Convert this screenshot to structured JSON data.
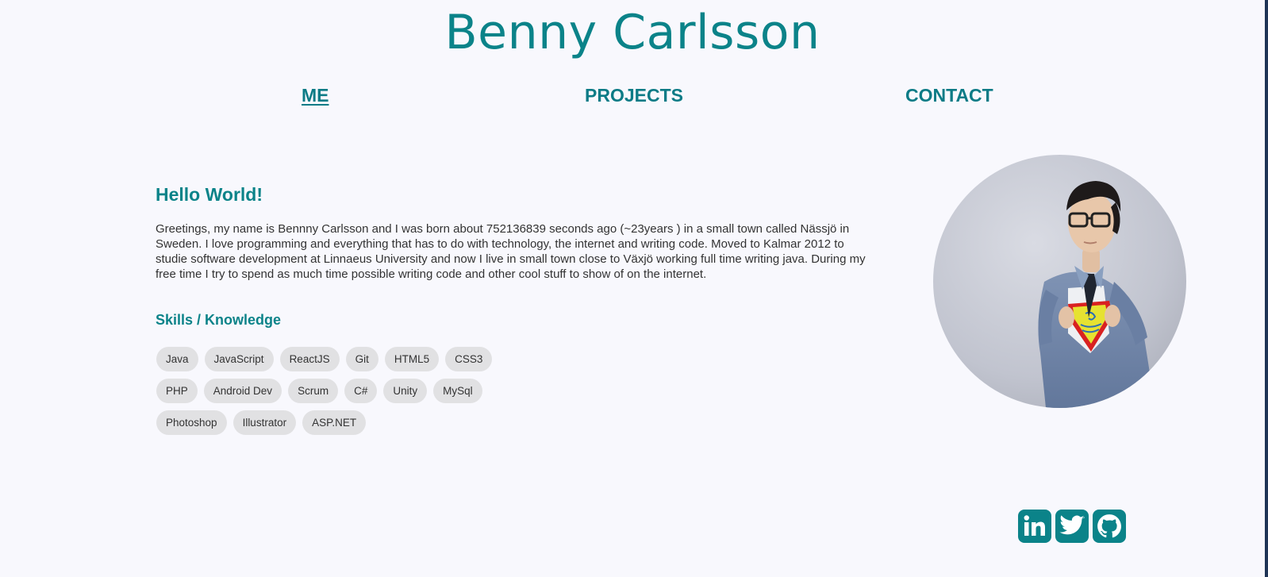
{
  "header": {
    "title": "Benny Carlsson"
  },
  "nav": {
    "items": [
      {
        "label": "ME"
      },
      {
        "label": "PROJECTS"
      },
      {
        "label": "CONTACT"
      }
    ],
    "active": "ME"
  },
  "about": {
    "heading": "Hello World!",
    "intro": "Greetings, my name is Bennny Carlsson and I was born about 752136839 seconds ago (~23years ) in a small town called Nässjö in Sweden. I love programming and everything that has to do with technology, the internet and writing code. Moved to Kalmar 2012 to studie software development at Linnaeus University and now I live in small town close to Växjö working full time writing java. During my free time I try to spend as much time possible writing code and other cool stuff to show of on the internet.",
    "skills_heading": "Skills / Knowledge",
    "skills": [
      "Java",
      "JavaScript",
      "ReactJS",
      "Git",
      "HTML5",
      "CSS3",
      "PHP",
      "Android Dev",
      "Scrum",
      "C#",
      "Unity",
      "MySql",
      "Photoshop",
      "Illustrator",
      "ASP.NET"
    ]
  },
  "social": {
    "icons": [
      "linkedin-icon",
      "twitter-icon",
      "github-icon"
    ]
  },
  "colors": {
    "accent": "#0b8389",
    "background": "#f8f8fd",
    "tag_background": "#e1e1e3"
  }
}
